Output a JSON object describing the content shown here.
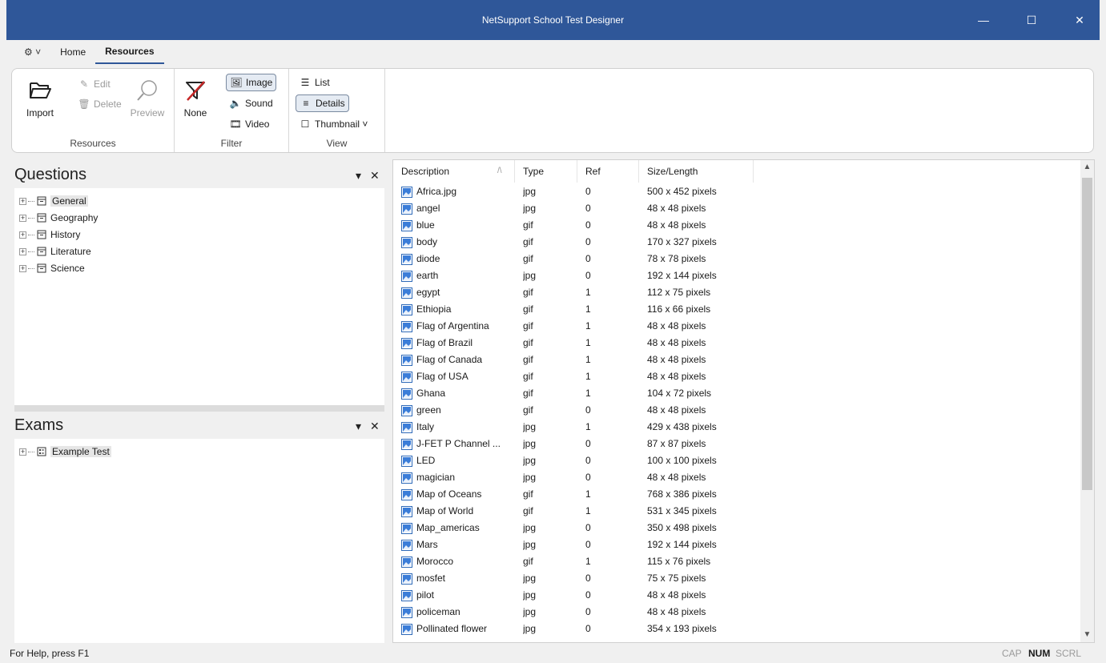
{
  "window": {
    "title": "NetSupport School Test Designer",
    "minimize": "—",
    "maximize": "☐",
    "close": "✕"
  },
  "tabs": {
    "quick_access": "⚙ ˅",
    "home": "Home",
    "resources": "Resources"
  },
  "ribbon": {
    "resources": {
      "label": "Resources",
      "import": "Import",
      "edit": "Edit",
      "delete": "Delete",
      "preview": "Preview"
    },
    "filter": {
      "label": "Filter",
      "none": "None",
      "image": "Image",
      "sound": "Sound",
      "video": "Video"
    },
    "view": {
      "label": "View",
      "list": "List",
      "details": "Details",
      "thumbnail": "Thumbnail ˅"
    }
  },
  "questions": {
    "title": "Questions",
    "items": [
      {
        "label": "General",
        "selected": true
      },
      {
        "label": "Geography"
      },
      {
        "label": "History"
      },
      {
        "label": "Literature"
      },
      {
        "label": "Science"
      }
    ]
  },
  "exams": {
    "title": "Exams",
    "items": [
      {
        "label": "Example Test"
      }
    ]
  },
  "panel_controls": {
    "pin": "▾",
    "close": "✕"
  },
  "resources_list": {
    "columns": {
      "description": "Description",
      "sort": "/\\",
      "type": "Type",
      "ref": "Ref",
      "size": "Size/Length"
    },
    "rows": [
      {
        "desc": "Africa.jpg",
        "type": "jpg",
        "ref": "0",
        "size": "500 x 452 pixels"
      },
      {
        "desc": "angel",
        "type": "jpg",
        "ref": "0",
        "size": "48 x 48 pixels"
      },
      {
        "desc": "blue",
        "type": "gif",
        "ref": "0",
        "size": "48 x 48 pixels"
      },
      {
        "desc": "body",
        "type": "gif",
        "ref": "0",
        "size": "170 x 327 pixels"
      },
      {
        "desc": "diode",
        "type": "gif",
        "ref": "0",
        "size": "78 x 78 pixels"
      },
      {
        "desc": "earth",
        "type": "jpg",
        "ref": "0",
        "size": "192 x 144 pixels"
      },
      {
        "desc": "egypt",
        "type": "gif",
        "ref": "1",
        "size": "112 x 75 pixels"
      },
      {
        "desc": "Ethiopia",
        "type": "gif",
        "ref": "1",
        "size": "116 x 66 pixels"
      },
      {
        "desc": "Flag of Argentina",
        "type": "gif",
        "ref": "1",
        "size": "48 x 48 pixels"
      },
      {
        "desc": "Flag of Brazil",
        "type": "gif",
        "ref": "1",
        "size": "48 x 48 pixels"
      },
      {
        "desc": "Flag of Canada",
        "type": "gif",
        "ref": "1",
        "size": "48 x 48 pixels"
      },
      {
        "desc": "Flag of USA",
        "type": "gif",
        "ref": "1",
        "size": "48 x 48 pixels"
      },
      {
        "desc": "Ghana",
        "type": "gif",
        "ref": "1",
        "size": "104 x 72 pixels"
      },
      {
        "desc": "green",
        "type": "gif",
        "ref": "0",
        "size": "48 x 48 pixels"
      },
      {
        "desc": "Italy",
        "type": "jpg",
        "ref": "1",
        "size": "429 x 438 pixels"
      },
      {
        "desc": "J-FET P Channel ...",
        "type": "jpg",
        "ref": "0",
        "size": "87 x 87 pixels"
      },
      {
        "desc": "LED",
        "type": "jpg",
        "ref": "0",
        "size": "100 x 100 pixels"
      },
      {
        "desc": "magician",
        "type": "jpg",
        "ref": "0",
        "size": "48 x 48 pixels"
      },
      {
        "desc": "Map of Oceans",
        "type": "gif",
        "ref": "1",
        "size": "768 x 386 pixels"
      },
      {
        "desc": "Map of World",
        "type": "gif",
        "ref": "1",
        "size": "531 x 345 pixels"
      },
      {
        "desc": "Map_americas",
        "type": "jpg",
        "ref": "0",
        "size": "350 x 498 pixels"
      },
      {
        "desc": "Mars",
        "type": "jpg",
        "ref": "0",
        "size": "192 x 144 pixels"
      },
      {
        "desc": "Morocco",
        "type": "gif",
        "ref": "1",
        "size": "115 x 76 pixels"
      },
      {
        "desc": "mosfet",
        "type": "jpg",
        "ref": "0",
        "size": "75 x 75 pixels"
      },
      {
        "desc": "pilot",
        "type": "jpg",
        "ref": "0",
        "size": "48 x 48 pixels"
      },
      {
        "desc": "policeman",
        "type": "jpg",
        "ref": "0",
        "size": "48 x 48 pixels"
      },
      {
        "desc": "Pollinated flower",
        "type": "jpg",
        "ref": "0",
        "size": "354 x 193 pixels"
      }
    ]
  },
  "statusbar": {
    "help": "For Help, press F1",
    "cap": "CAP",
    "num": "NUM",
    "scrl": "SCRL"
  },
  "colors": {
    "titlebar": "#2f5799",
    "accent": "#2f5799"
  }
}
